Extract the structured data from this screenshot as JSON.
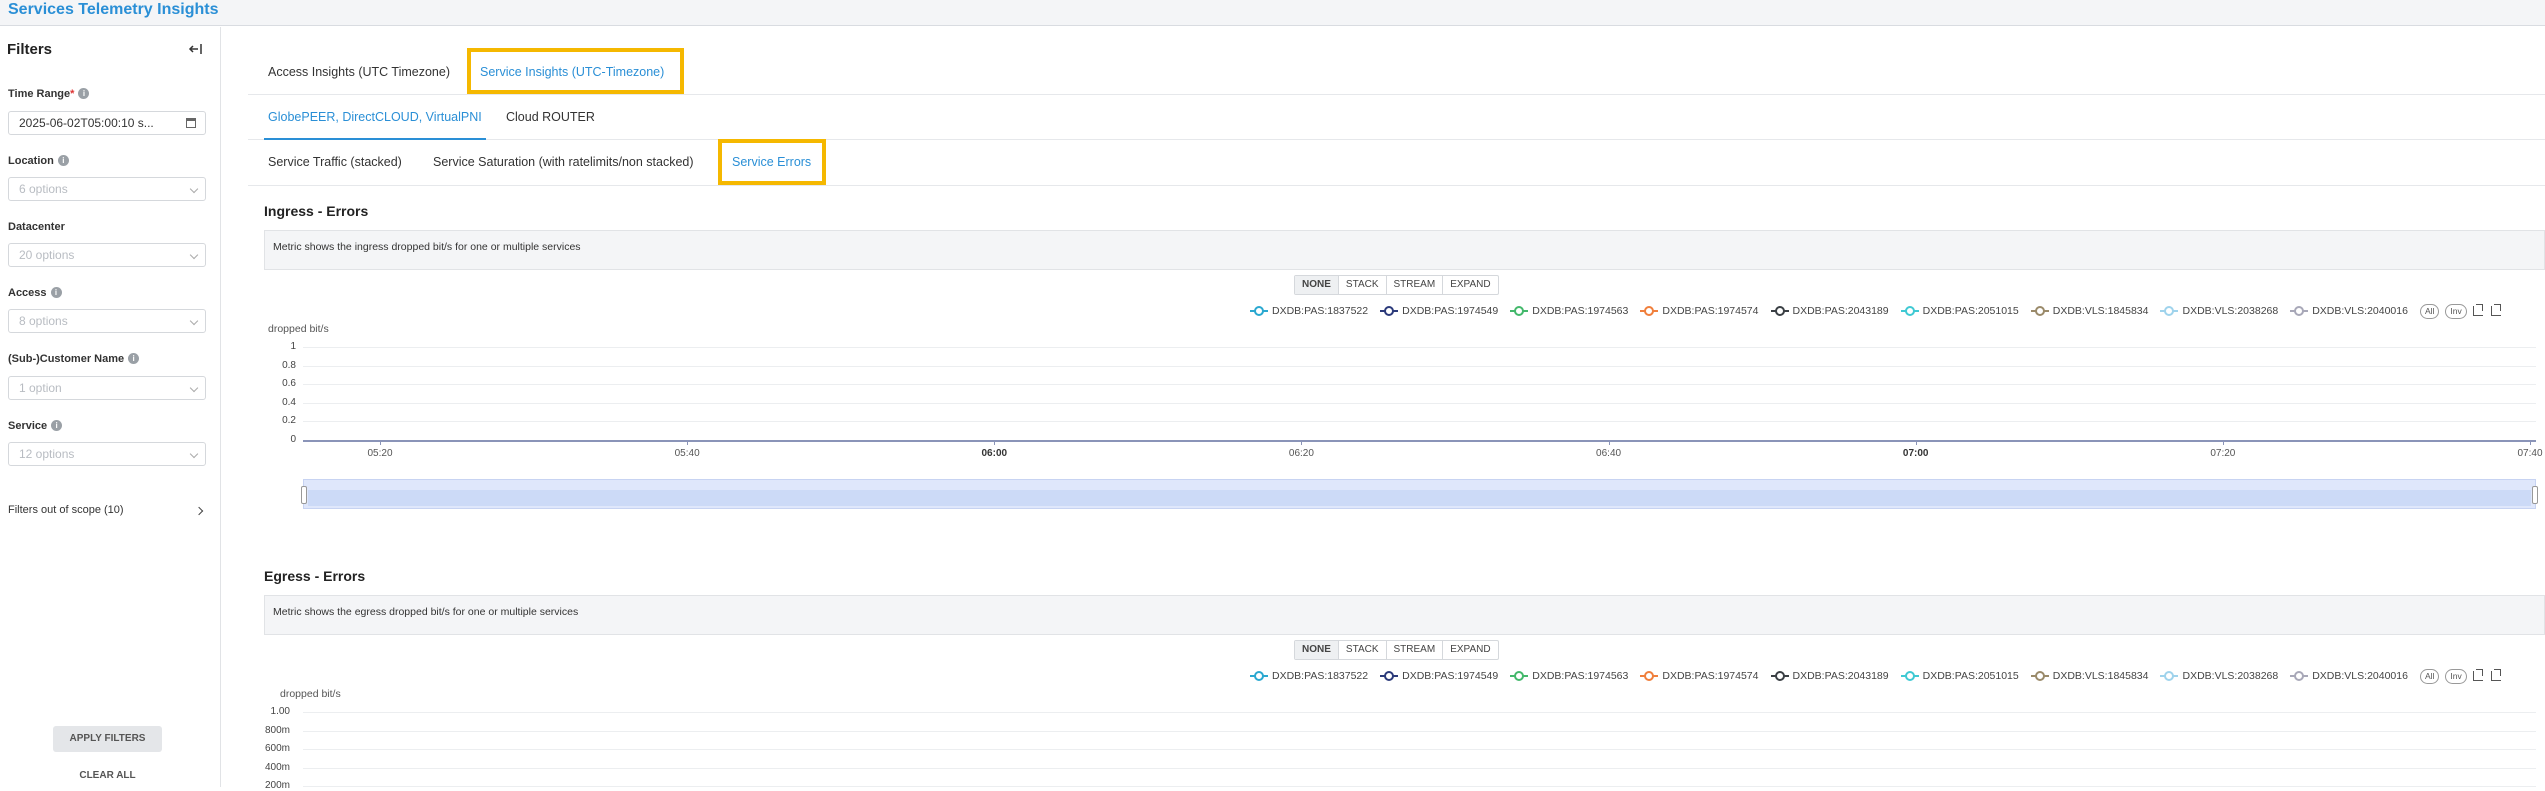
{
  "app": {
    "title": "Services Telemetry Insights"
  },
  "sidebar": {
    "title": "Filters",
    "time_range": {
      "label": "Time Range",
      "value": "2025-06-02T05:00:10 s..."
    },
    "location": {
      "label": "Location",
      "placeholder": "6 options"
    },
    "datacenter": {
      "label": "Datacenter",
      "placeholder": "20 options"
    },
    "access": {
      "label": "Access",
      "placeholder": "8 options"
    },
    "customer": {
      "label": "(Sub-)Customer Name",
      "placeholder": "1 option"
    },
    "service": {
      "label": "Service",
      "placeholder": "12 options"
    },
    "out_of_scope": "Filters out of scope (10)",
    "apply_label": "APPLY FILTERS",
    "clear_label": "CLEAR ALL"
  },
  "tabs_level1": [
    "Access Insights (UTC Timezone)",
    "Service Insights (UTC-Timezone)"
  ],
  "tabs_level2": [
    "GlobePEER, DirectCLOUD, VirtualPNI",
    "Cloud ROUTER"
  ],
  "tabs_level3": [
    "Service Traffic (stacked)",
    "Service Saturation (with ratelimits/non stacked)",
    "Service Errors"
  ],
  "colors": {
    "accent": "#2a8fd6",
    "highlight": "#f5b800"
  },
  "toolbar": [
    "NONE",
    "STACK",
    "STREAM",
    "EXPAND"
  ],
  "legend_extra": {
    "all": "All",
    "inv": "Inv"
  },
  "series": [
    {
      "name": "DXDB:PAS:1837522",
      "color": "#2aa8d0"
    },
    {
      "name": "DXDB:PAS:1974549",
      "color": "#2b3a7a"
    },
    {
      "name": "DXDB:PAS:1974563",
      "color": "#43b86b"
    },
    {
      "name": "DXDB:PAS:1974574",
      "color": "#f07f3c"
    },
    {
      "name": "DXDB:PAS:2043189",
      "color": "#3a3f44"
    },
    {
      "name": "DXDB:PAS:2051015",
      "color": "#3fc9d3"
    },
    {
      "name": "DXDB:VLS:1845834",
      "color": "#9a8a6a"
    },
    {
      "name": "DXDB:VLS:2038268",
      "color": "#9fd3ec"
    },
    {
      "name": "DXDB:VLS:2040016",
      "color": "#a8a8b8"
    }
  ],
  "ingress": {
    "title": "Ingress - Errors",
    "description": "Metric shows the ingress dropped bit/s for one or multiple services",
    "ylabel": "dropped bit/s",
    "yticks": [
      "1",
      "0.8",
      "0.6",
      "0.4",
      "0.2",
      "0"
    ],
    "xticks": [
      {
        "label": "05:20",
        "bold": false
      },
      {
        "label": "05:40",
        "bold": false
      },
      {
        "label": "06:00",
        "bold": true
      },
      {
        "label": "06:20",
        "bold": false
      },
      {
        "label": "06:40",
        "bold": false
      },
      {
        "label": "07:00",
        "bold": true
      },
      {
        "label": "07:20",
        "bold": false
      },
      {
        "label": "07:40",
        "bold": false
      }
    ]
  },
  "egress": {
    "title": "Egress - Errors",
    "description": "Metric shows the egress dropped bit/s for one or multiple services",
    "ylabel": "dropped bit/s",
    "yticks": [
      "1.00",
      "800m",
      "600m",
      "400m",
      "200m"
    ]
  },
  "chart_data": [
    {
      "type": "line",
      "title": "Ingress - Errors",
      "ylabel": "dropped bit/s",
      "ylim": [
        0,
        1
      ],
      "x": [
        "05:20",
        "05:40",
        "06:00",
        "06:20",
        "06:40",
        "07:00",
        "07:20",
        "07:40"
      ],
      "series_note_hidden": true,
      "series": [
        {
          "name": "DXDB:PAS:1837522",
          "values": [
            0,
            0,
            0,
            0,
            0,
            0,
            0,
            0
          ]
        }
      ],
      "legend": "top-right",
      "grid": true
    },
    {
      "type": "line",
      "title": "Egress - Errors",
      "ylabel": "dropped bit/s",
      "ylim": [
        0,
        1
      ],
      "legend": "top-right",
      "grid": true
    }
  ]
}
